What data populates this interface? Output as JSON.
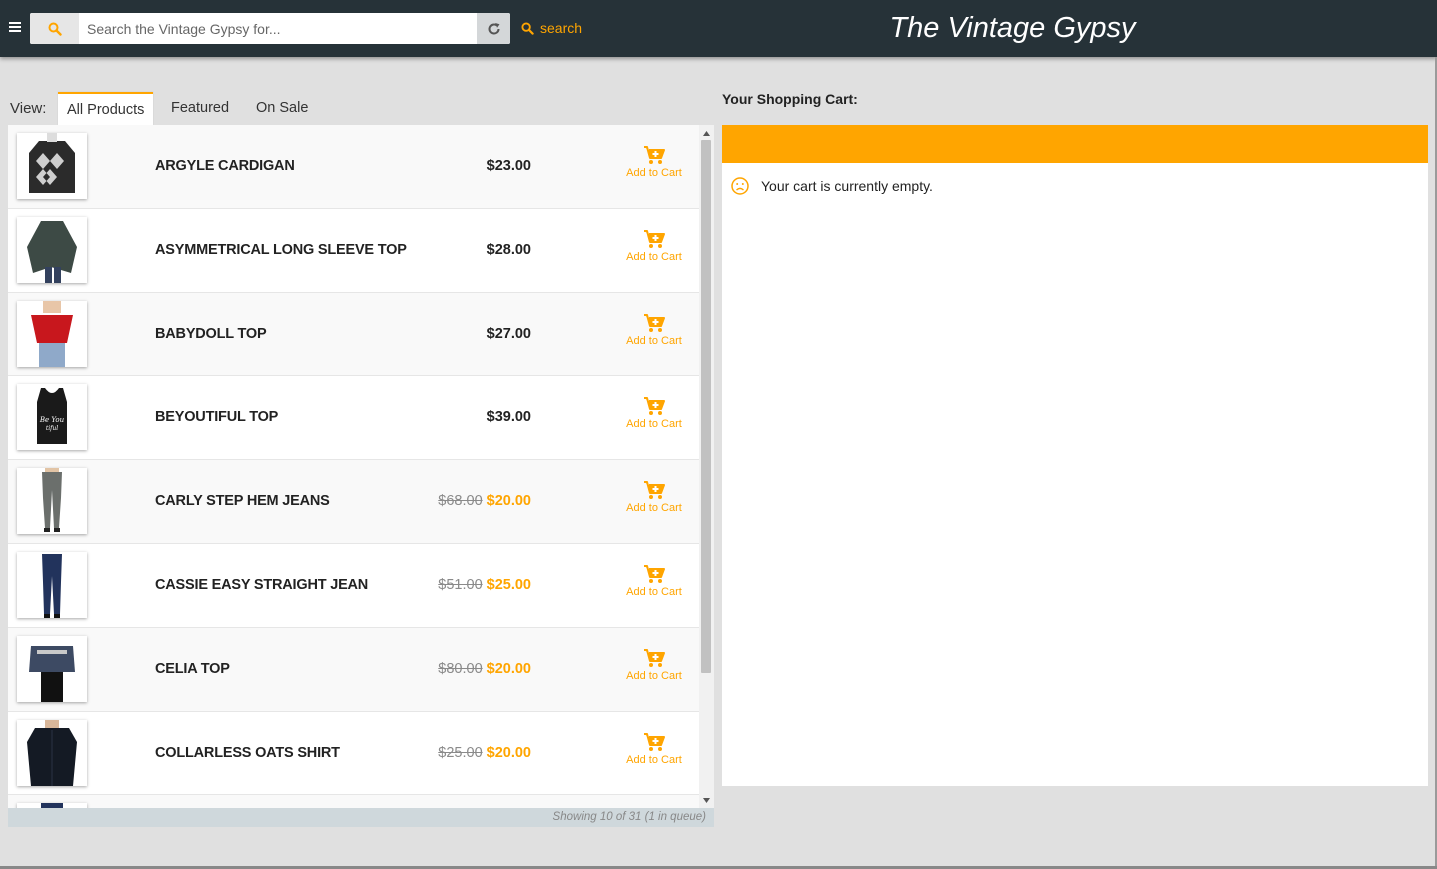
{
  "header": {
    "brand": "The Vintage Gypsy",
    "search_placeholder": "Search the Vintage Gypsy for...",
    "search_value": "",
    "search_link": "search",
    "bg_color": "#263238",
    "accent_color": "#ffa500"
  },
  "tabs": {
    "view_label": "View:",
    "items": [
      "All Products",
      "Featured",
      "On Sale"
    ],
    "active": "All Products"
  },
  "products": [
    {
      "name": "ARGYLE CARDIGAN",
      "price": "$23.00",
      "old_price": "",
      "sale_price": "",
      "action": "Add to Cart",
      "image": "cardigan"
    },
    {
      "name": "ASYMMETRICAL LONG SLEEVE TOP",
      "price": "$28.00",
      "old_price": "",
      "sale_price": "",
      "action": "Add to Cart",
      "image": "long-top"
    },
    {
      "name": "BABYDOLL TOP",
      "price": "$27.00",
      "old_price": "",
      "sale_price": "",
      "action": "Add to Cart",
      "image": "red-top"
    },
    {
      "name": "BEYOUTIFUL TOP",
      "price": "$39.00",
      "old_price": "",
      "sale_price": "",
      "action": "Add to Cart",
      "image": "tank-top"
    },
    {
      "name": "CARLY STEP HEM JEANS",
      "price": "",
      "old_price": "$68.00",
      "sale_price": "$20.00",
      "action": "Add to Cart",
      "image": "grey-jeans"
    },
    {
      "name": "CASSIE EASY STRAIGHT JEAN",
      "price": "",
      "old_price": "$51.00",
      "sale_price": "$25.00",
      "action": "Add to Cart",
      "image": "blue-jeans"
    },
    {
      "name": "CELIA TOP",
      "price": "",
      "old_price": "$80.00",
      "sale_price": "$20.00",
      "action": "Add to Cart",
      "image": "celia-top"
    },
    {
      "name": "COLLARLESS OATS SHIRT",
      "price": "",
      "old_price": "$25.00",
      "sale_price": "$20.00",
      "action": "Add to Cart",
      "image": "shirt"
    }
  ],
  "list_status": "Showing 10 of 31 (1 in queue)",
  "cart": {
    "title": "Your Shopping Cart:",
    "empty_message": "Your cart is currently empty."
  }
}
